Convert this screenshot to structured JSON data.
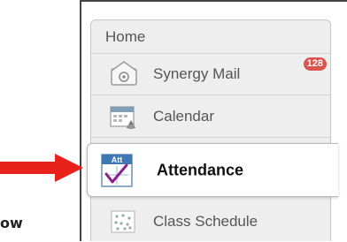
{
  "menu": {
    "home_label": "Home",
    "items": [
      {
        "label": "Synergy Mail",
        "icon": "mail-icon",
        "badge": "128"
      },
      {
        "label": "Calendar",
        "icon": "calendar-icon"
      },
      {
        "label": "Attendance",
        "icon": "attendance-icon",
        "icon_text": "Att",
        "active": true
      },
      {
        "label": "Class Schedule",
        "icon": "class-schedule-icon"
      }
    ]
  },
  "annotation": {
    "arrow_color": "#e8221b",
    "cut_off_text": "ow"
  }
}
